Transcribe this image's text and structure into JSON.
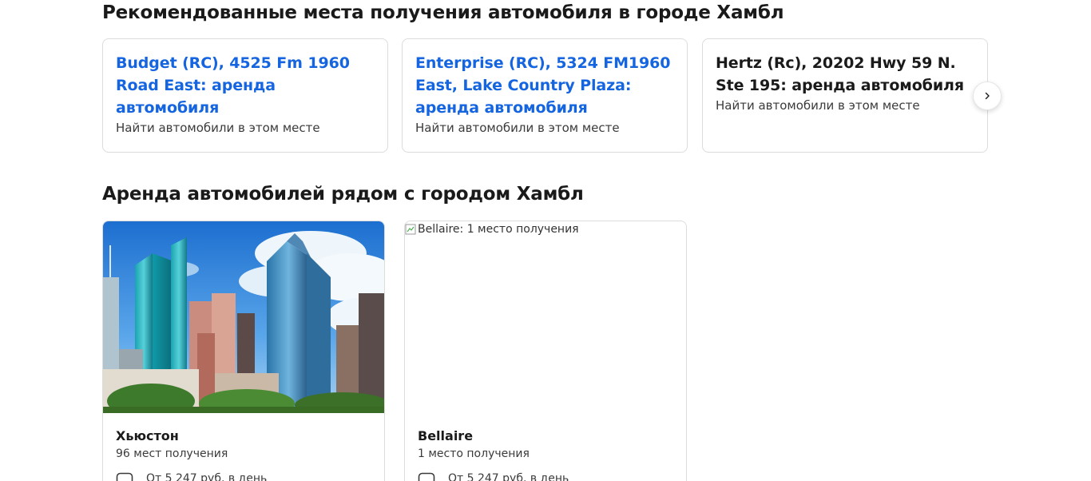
{
  "featured_section": {
    "title": "Рекомендованные места получения автомобиля в городе Хамбл",
    "cards": [
      {
        "title": "Budget (RC), 4525 Fm 1960 Road East: аренда автомобиля",
        "subtitle": "Найти автомобили в этом месте",
        "is_link": true
      },
      {
        "title": "Enterprise (RC), 5324 FM1960 East, Lake Country Plaza: аренда автомобиля",
        "subtitle": "Найти автомобили в этом месте",
        "is_link": true
      },
      {
        "title": "Hertz (Rc), 20202 Hwy 59 N. Ste 195: аренда автомобиля",
        "subtitle": "Найти автомобили в этом месте",
        "is_link": false
      }
    ],
    "next_button_icon": "chevron-right-icon"
  },
  "nearby_section": {
    "title": "Аренда автомобилей рядом с городом Хамбл",
    "cities": [
      {
        "name": "Хьюстон",
        "count": "96 мест получения",
        "price": "От 5 247 руб. в день",
        "image": "houston-skyline"
      },
      {
        "name": "Bellaire",
        "count": "1 место получения",
        "price": "От 5 247 руб. в день",
        "image_alt": "Bellaire: 1 место получения"
      }
    ]
  },
  "colors": {
    "link": "#1565e0",
    "text": "#1a1a1a",
    "border": "#dcdcdc"
  }
}
